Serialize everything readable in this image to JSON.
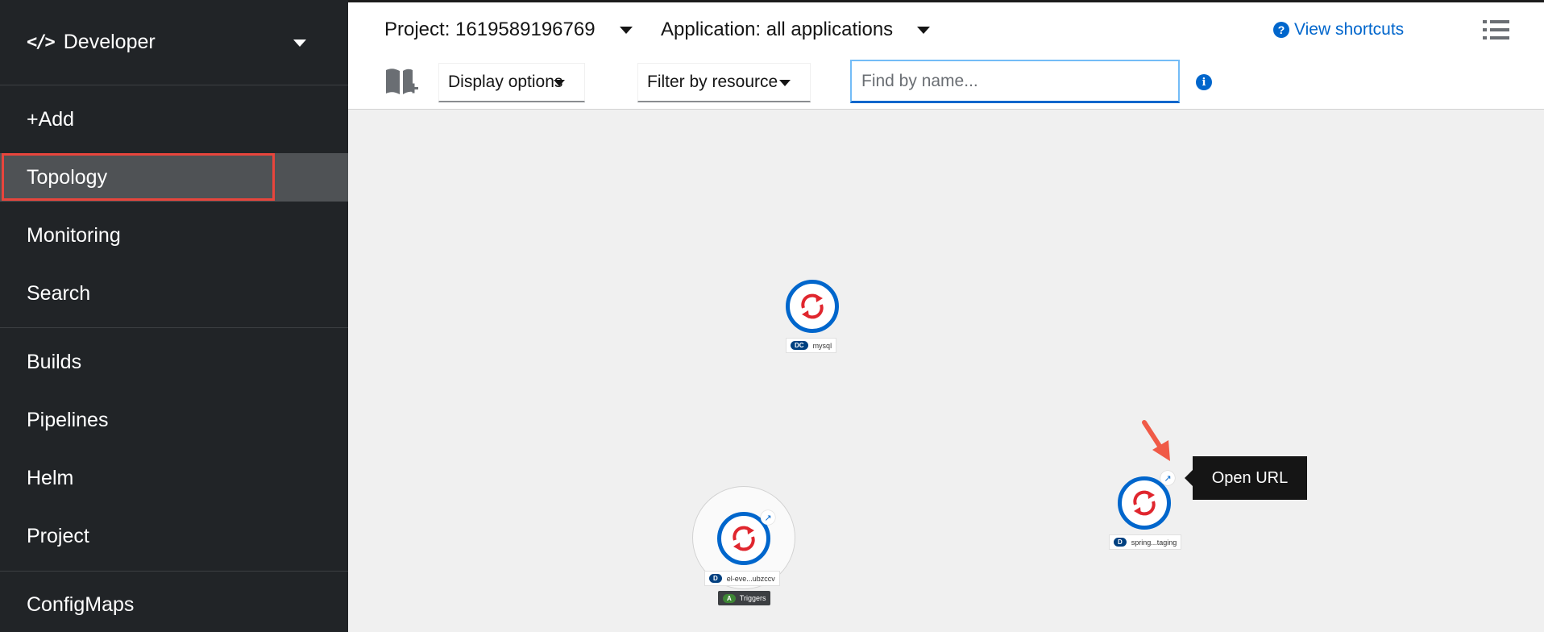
{
  "perspective": {
    "label": "Developer",
    "icon": "code-icon"
  },
  "sidebar": {
    "items": [
      {
        "label": "+Add"
      },
      {
        "label": "Topology"
      },
      {
        "label": "Monitoring"
      },
      {
        "label": "Search"
      },
      {
        "label": "Builds"
      },
      {
        "label": "Pipelines"
      },
      {
        "label": "Helm"
      },
      {
        "label": "Project"
      },
      {
        "label": "ConfigMaps"
      }
    ],
    "active": "Topology"
  },
  "masthead": {
    "project": "Project: 1619589196769",
    "application": "Application: all applications",
    "shortcuts": "View shortcuts"
  },
  "toolbar": {
    "display_options": "Display options",
    "filter_by_resource": "Filter by resource",
    "find_placeholder": "Find by name...",
    "info_glyph": "i"
  },
  "topology": {
    "nodes": [
      {
        "kind": "DC",
        "name": "mysql"
      },
      {
        "kind": "D",
        "name": "el-eve...ubzccv",
        "trigger_badge": "A",
        "trigger_label": "Triggers"
      },
      {
        "kind": "D",
        "name": "spring...taging"
      }
    ],
    "tooltip": "Open URL"
  },
  "colors": {
    "sidebar_bg": "#212427",
    "active_bg": "#4f5255",
    "highlight": "#e8453c",
    "link": "#0066cc",
    "canvas_bg": "#f0f0f0",
    "node_ring": "#0066cc",
    "node_icon": "#e0262e"
  }
}
